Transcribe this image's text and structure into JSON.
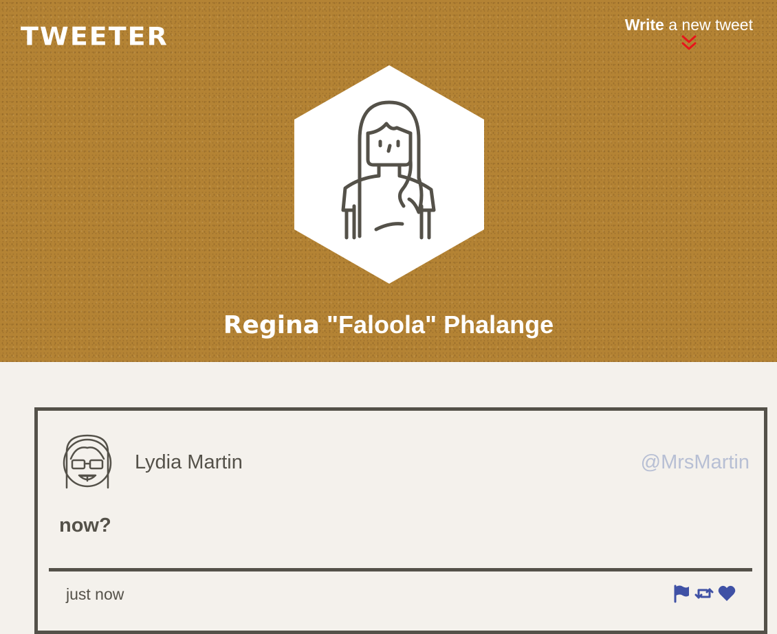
{
  "header": {
    "logo": "TWEETER",
    "compose": {
      "bold_label": "Write",
      "label": " a new tweet",
      "icon": "chevron-double-down-icon",
      "icon_color": "#e8141b"
    },
    "profile": {
      "name_first": "Regina",
      "name_rest": " \"Faloola\" Phalange",
      "avatar_icon": "woman-avatar-icon"
    },
    "background_color": "#b48334"
  },
  "tweets": [
    {
      "author_name": "Lydia Martin",
      "handle": "@MrsMartin",
      "avatar_icon": "girl-with-glasses-avatar-icon",
      "text": "now?",
      "time": "just now",
      "actions": [
        {
          "name": "flag-icon"
        },
        {
          "name": "retweet-icon"
        },
        {
          "name": "heart-icon"
        }
      ]
    }
  ],
  "colors": {
    "text_dark": "#545149",
    "handle": "#b7bfd4",
    "action_icons": "#3f51a5",
    "page_background": "#f4f1ec"
  }
}
